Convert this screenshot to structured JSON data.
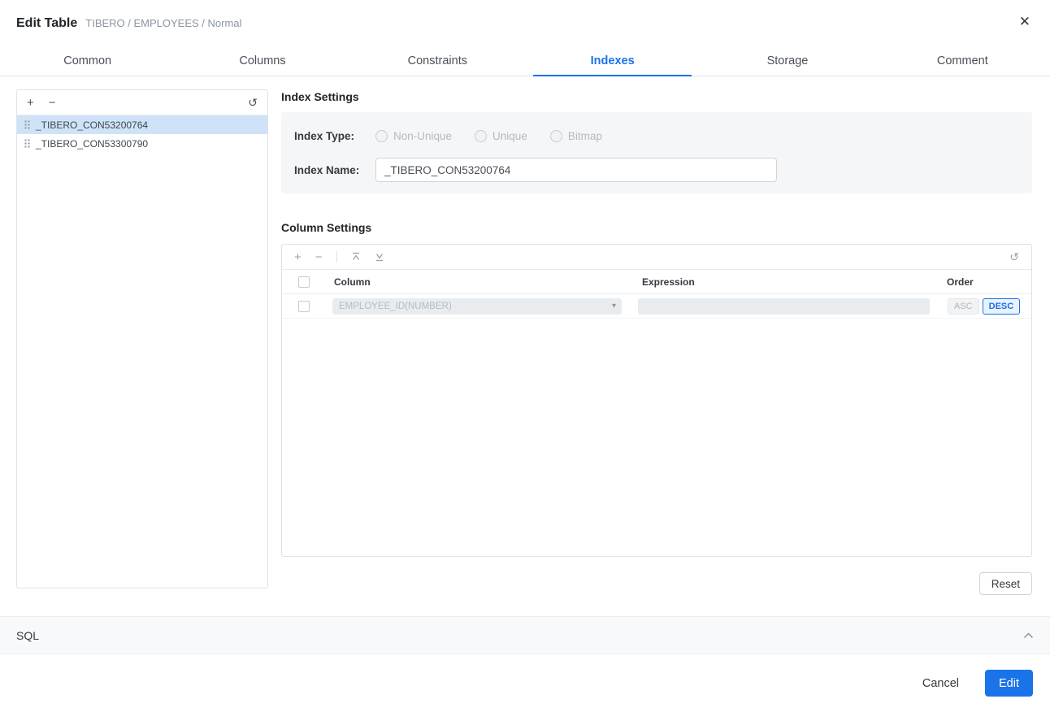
{
  "header": {
    "title": "Edit Table",
    "subtitle": "TIBERO / EMPLOYEES / Normal"
  },
  "tabs": [
    {
      "label": "Common",
      "active": false
    },
    {
      "label": "Columns",
      "active": false
    },
    {
      "label": "Constraints",
      "active": false
    },
    {
      "label": "Indexes",
      "active": true
    },
    {
      "label": "Storage",
      "active": false
    },
    {
      "label": "Comment",
      "active": false
    }
  ],
  "index_list": {
    "items": [
      {
        "name": "_TIBERO_CON53200764",
        "selected": true
      },
      {
        "name": "_TIBERO_CON53300790",
        "selected": false
      }
    ]
  },
  "index_settings": {
    "section_title": "Index Settings",
    "index_type_label": "Index Type:",
    "index_type_options": [
      "Non-Unique",
      "Unique",
      "Bitmap"
    ],
    "index_name_label": "Index Name:",
    "index_name_value": "_TIBERO_CON53200764"
  },
  "column_settings": {
    "section_title": "Column Settings",
    "table": {
      "headers": [
        "Column",
        "Expression",
        "Order"
      ],
      "rows": [
        {
          "column": "EMPLOYEE_ID(NUMBER)",
          "expression": "",
          "order": "DESC"
        }
      ]
    },
    "order_options": [
      "ASC",
      "DESC"
    ]
  },
  "sql_section": {
    "label": "SQL"
  },
  "buttons": {
    "reset": "Reset",
    "cancel": "Cancel",
    "edit": "Edit"
  },
  "icons": {
    "close": "✕",
    "add": "+",
    "remove": "−",
    "refresh": "↺",
    "select_caret": "▾"
  },
  "colors": {
    "accent": "#1a73e8",
    "selected_item_bg": "#cfe3f8",
    "panel_bg": "#f5f6f8",
    "disabled_field_bg": "#e9ecef"
  }
}
